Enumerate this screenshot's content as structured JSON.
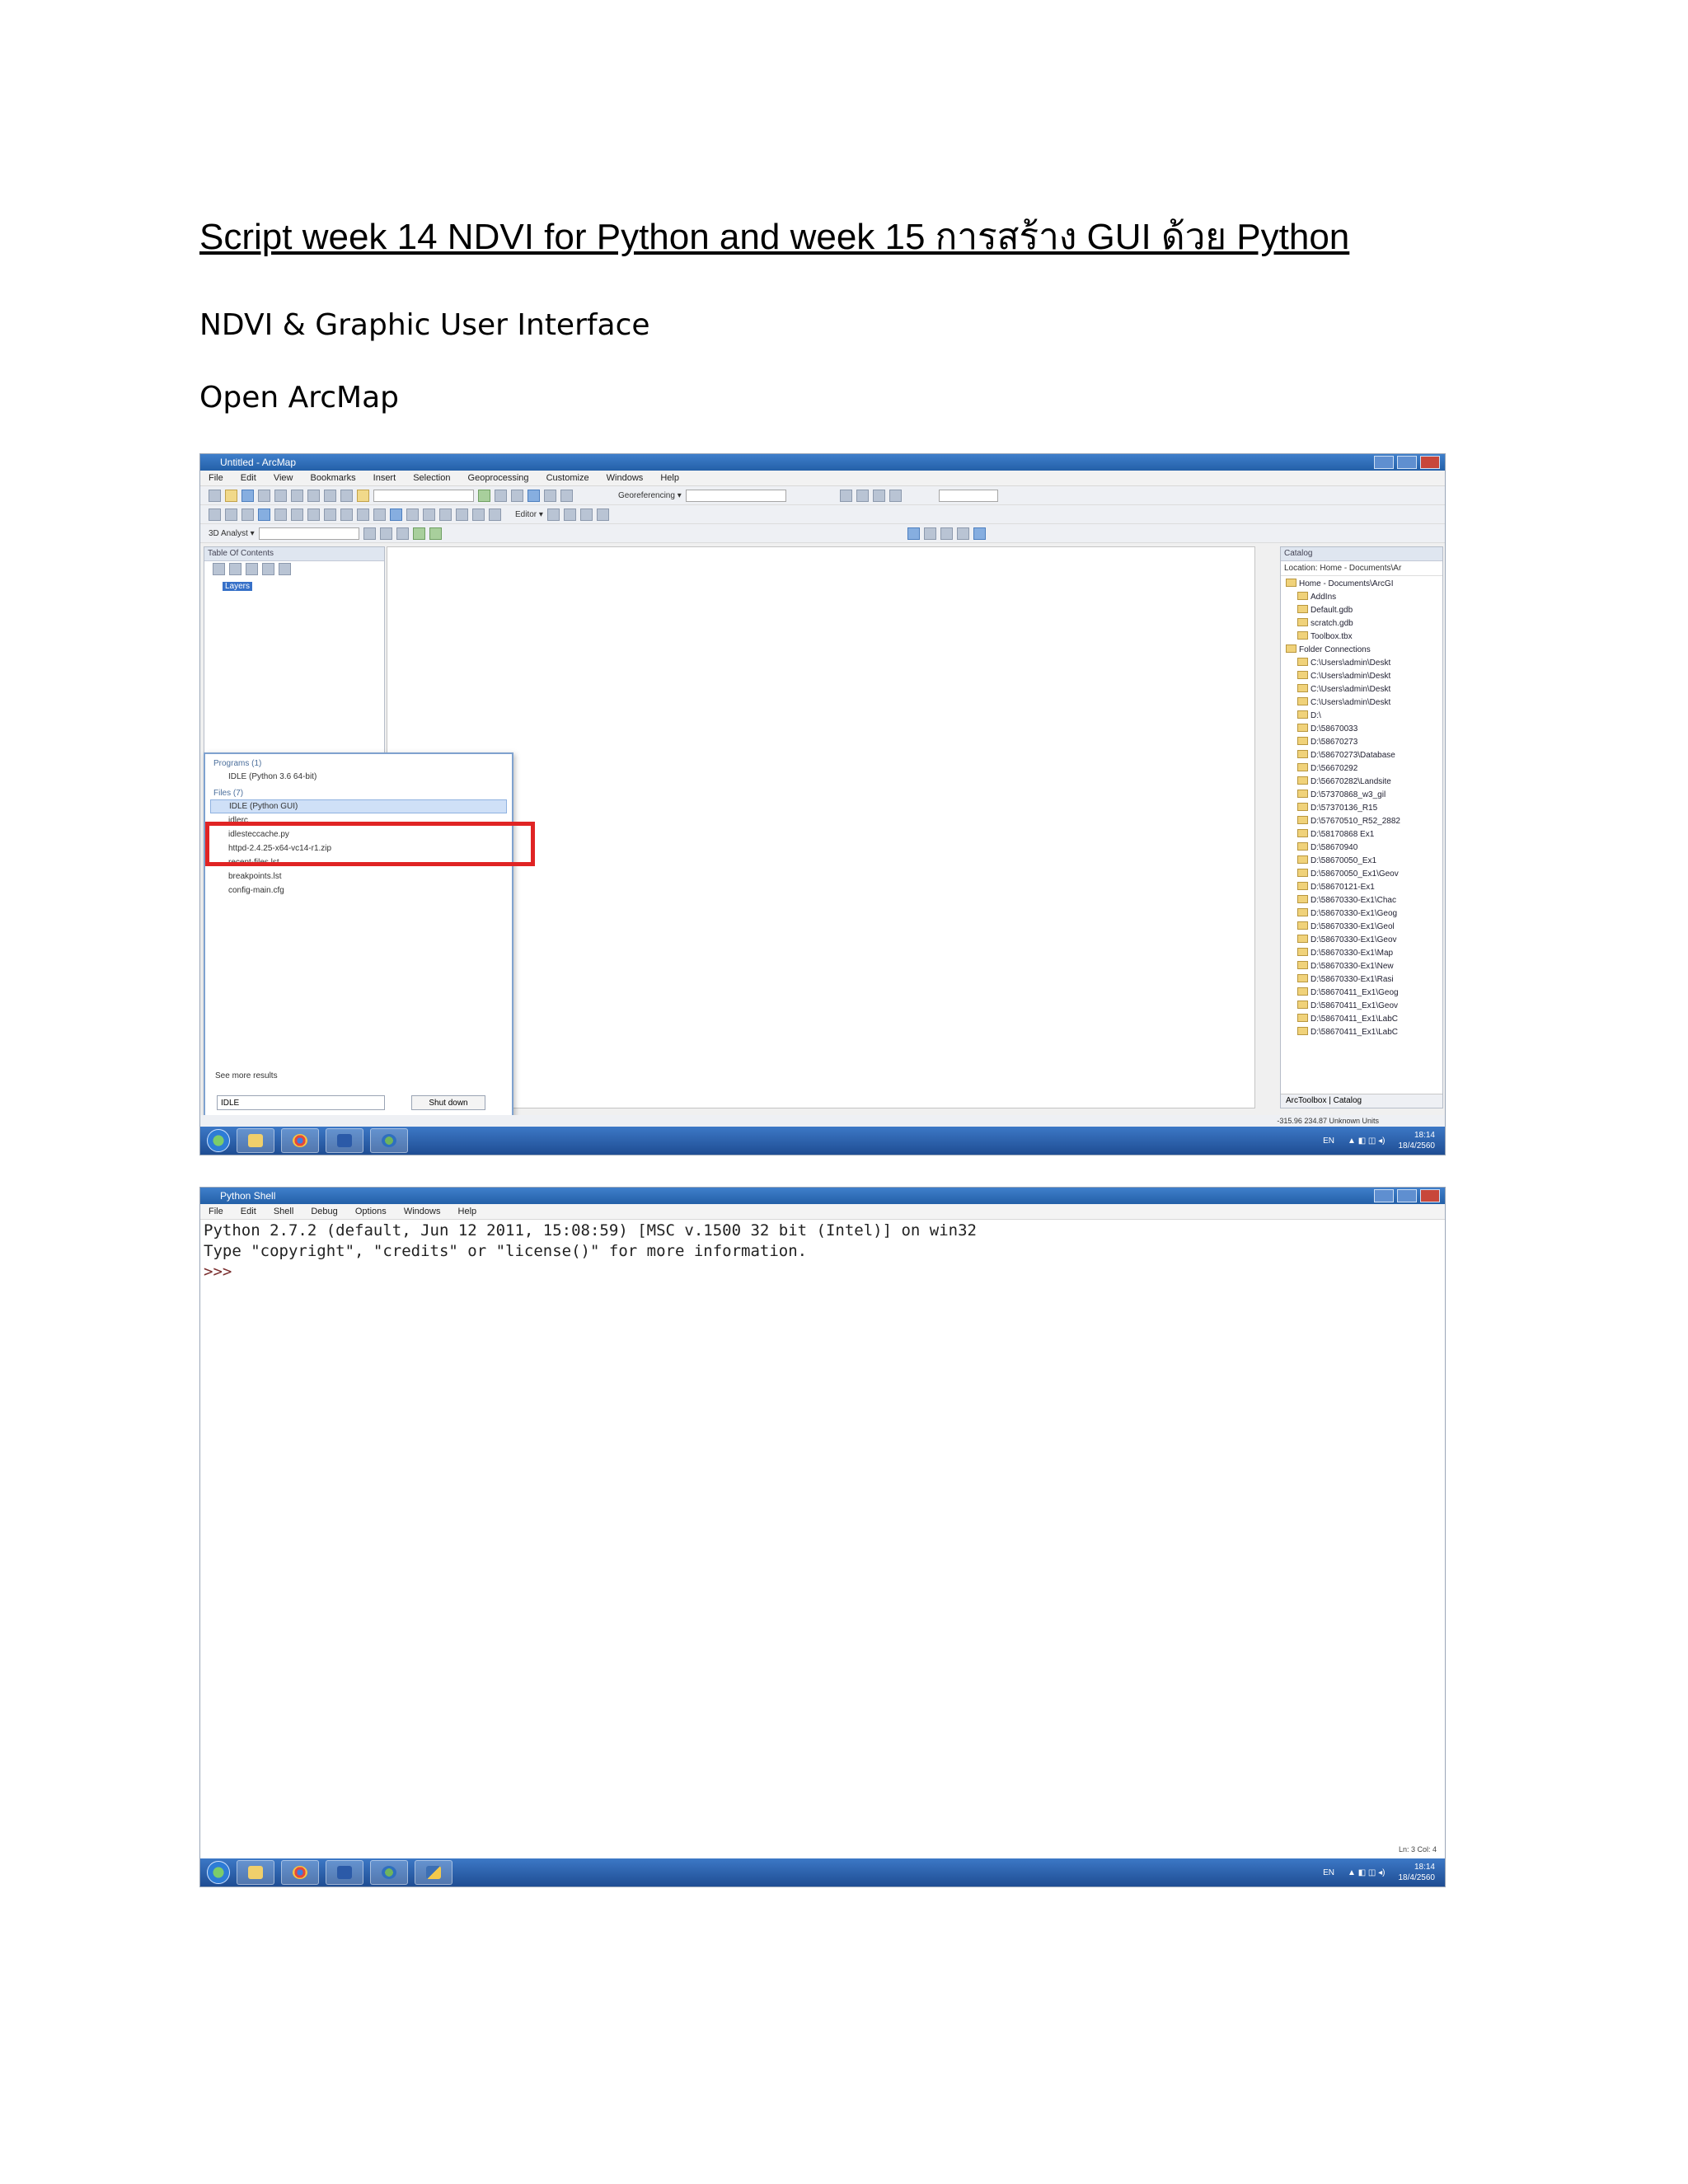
{
  "doc": {
    "title": "Script week 14  NDVI for Python and week 15  การสร้าง GUI ด้วย Python",
    "subtitle": "NDVI & Graphic User Interface",
    "step1": "Open ArcMap"
  },
  "arcmap": {
    "window_title": "Untitled - ArcMap",
    "menus": [
      "File",
      "Edit",
      "View",
      "Bookmarks",
      "Insert",
      "Selection",
      "Geoprocessing",
      "Customize",
      "Windows",
      "Help"
    ],
    "georeferencing_label": "Georeferencing ▾",
    "analyst_label": "3D Analyst ▾",
    "editor_label": "Editor ▾",
    "toc_title": "Table Of Contents",
    "toc_layer": "Layers",
    "catalog_title": "Catalog",
    "catalog_location_label": "Location:",
    "catalog_location_value": "Home - Documents\\Ar",
    "catalog_tree": [
      {
        "label": "Home - Documents\\ArcGI",
        "level": 0
      },
      {
        "label": "AddIns",
        "level": 1
      },
      {
        "label": "Default.gdb",
        "level": 1
      },
      {
        "label": "scratch.gdb",
        "level": 1
      },
      {
        "label": "Toolbox.tbx",
        "level": 1
      },
      {
        "label": "Folder Connections",
        "level": 0
      },
      {
        "label": "C:\\Users\\admin\\Deskt",
        "level": 1
      },
      {
        "label": "C:\\Users\\admin\\Deskt",
        "level": 1
      },
      {
        "label": "C:\\Users\\admin\\Deskt",
        "level": 1
      },
      {
        "label": "C:\\Users\\admin\\Deskt",
        "level": 1
      },
      {
        "label": "D:\\",
        "level": 1
      },
      {
        "label": "D:\\58670033",
        "level": 1
      },
      {
        "label": "D:\\58670273",
        "level": 1
      },
      {
        "label": "D:\\58670273\\Database",
        "level": 1
      },
      {
        "label": "D:\\56670292",
        "level": 1
      },
      {
        "label": "D:\\56670282\\Landsite",
        "level": 1
      },
      {
        "label": "D:\\57370868_w3_gil",
        "level": 1
      },
      {
        "label": "D:\\57370136_R15",
        "level": 1
      },
      {
        "label": "D:\\57670510_R52_2882",
        "level": 1
      },
      {
        "label": "D:\\58170868 Ex1",
        "level": 1
      },
      {
        "label": "D:\\58670940",
        "level": 1
      },
      {
        "label": "D:\\58670050_Ex1",
        "level": 1
      },
      {
        "label": "D:\\58670050_Ex1\\Geov",
        "level": 1
      },
      {
        "label": "D:\\58670121-Ex1",
        "level": 1
      },
      {
        "label": "D:\\58670330-Ex1\\Chac",
        "level": 1
      },
      {
        "label": "D:\\58670330-Ex1\\Geog",
        "level": 1
      },
      {
        "label": "D:\\58670330-Ex1\\Geol",
        "level": 1
      },
      {
        "label": "D:\\58670330-Ex1\\Geov",
        "level": 1
      },
      {
        "label": "D:\\58670330-Ex1\\Map",
        "level": 1
      },
      {
        "label": "D:\\58670330-Ex1\\New",
        "level": 1
      },
      {
        "label": "D:\\58670330-Ex1\\Rasi",
        "level": 1
      },
      {
        "label": "D:\\58670411_Ex1\\Geog",
        "level": 1
      },
      {
        "label": "D:\\58670411_Ex1\\Geov",
        "level": 1
      },
      {
        "label": "D:\\58670411_Ex1\\LabC",
        "level": 1
      },
      {
        "label": "D:\\58670411_Ex1\\LabC",
        "level": 1
      }
    ],
    "catalog_tabs": "ArcToolbox  |  Catalog",
    "status_coords": "-315.96  234.87 Unknown Units",
    "startmenu": {
      "programs_header": "Programs (1)",
      "programs": [
        "IDLE (Python 3.6 64-bit)"
      ],
      "files_header": "Files (7)",
      "selected": "IDLE (Python GUI)",
      "files": [
        "idlerc",
        "idlesteccache.py",
        "httpd-2.4.25-x64-vc14-r1.zip",
        "recent-files.lst",
        "breakpoints.lst",
        "config-main.cfg"
      ],
      "see_more": "See more results",
      "search_value": "IDLE",
      "shutdown_label": "Shut down"
    },
    "tray_lang": "EN",
    "tray_time": "18:14",
    "tray_date": "18/4/2560"
  },
  "python_shell": {
    "window_title": "Python Shell",
    "menus": [
      "File",
      "Edit",
      "Shell",
      "Debug",
      "Options",
      "Windows",
      "Help"
    ],
    "line1": "Python 2.7.2 (default, Jun 12 2011, 15:08:59) [MSC v.1500 32 bit (Intel)] on win32",
    "line2": "Type \"copyright\", \"credits\" or \"license()\" for more information.",
    "prompt": ">>>",
    "status": "Ln: 3 Col: 4",
    "tray_lang": "EN",
    "tray_time": "18:14",
    "tray_date": "18/4/2560"
  }
}
